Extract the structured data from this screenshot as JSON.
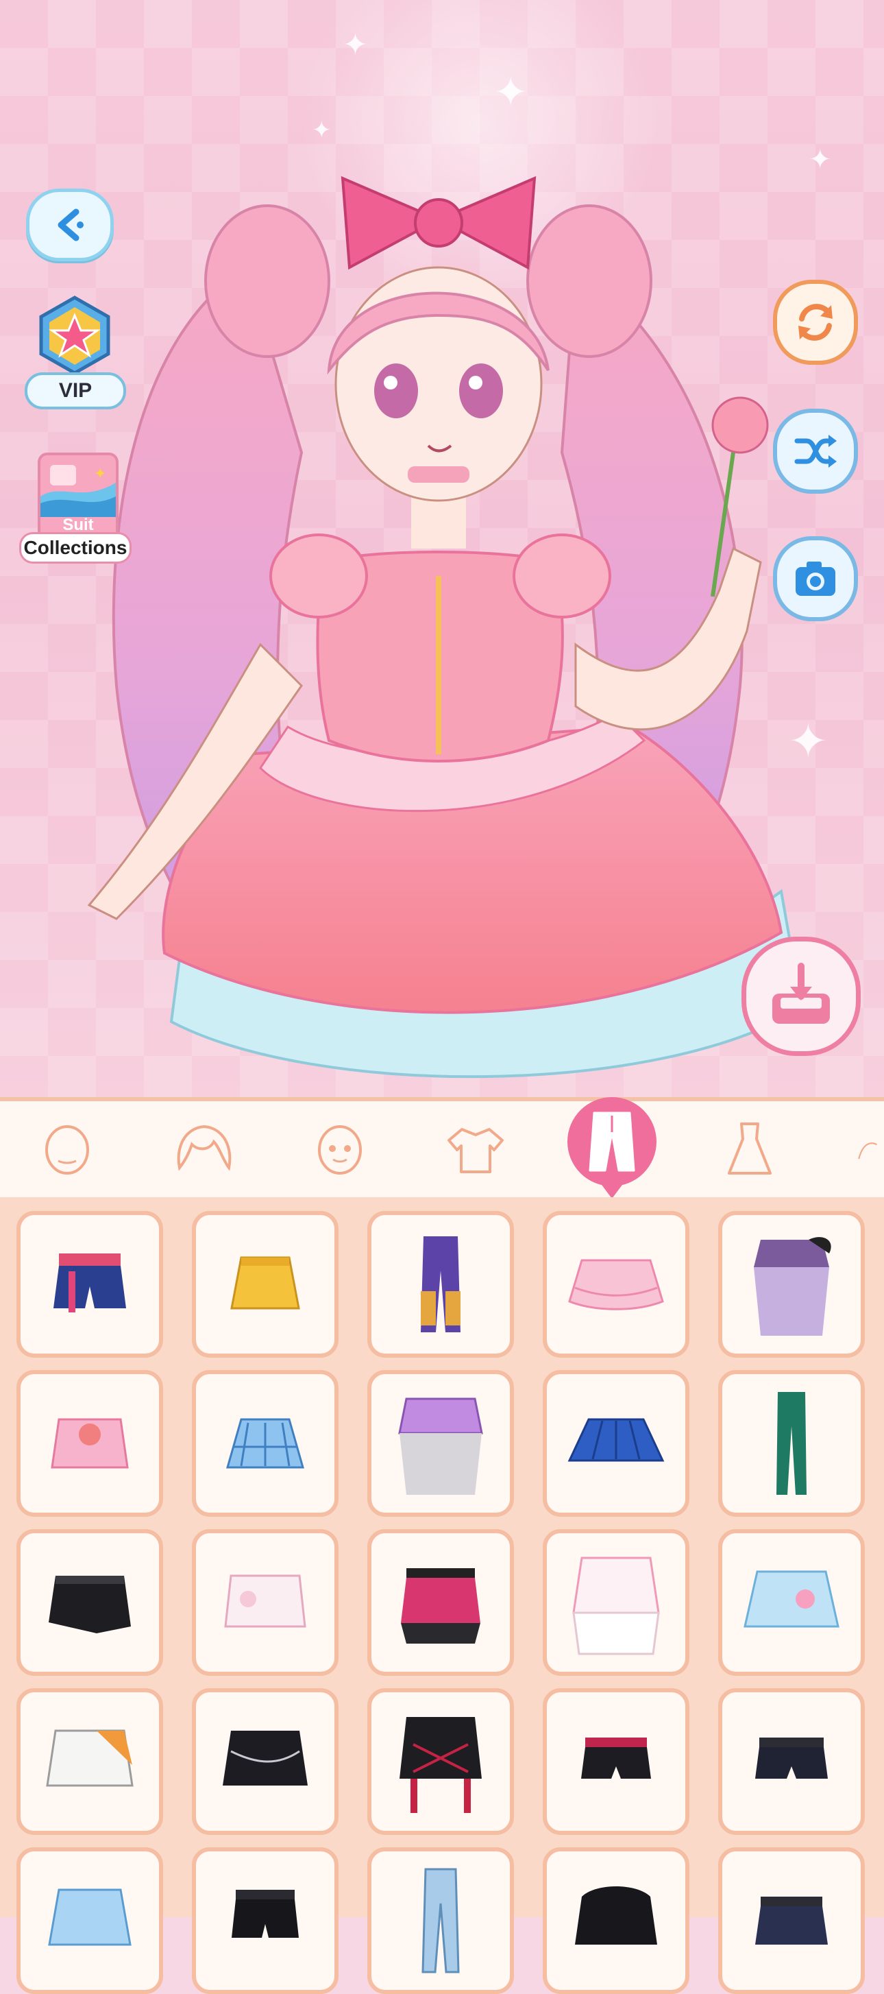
{
  "left_menu": {
    "vip_label": "VIP",
    "suit_label": "Suit",
    "collections_label": "Collections"
  },
  "tabs": [
    {
      "name": "face-tab",
      "icon": "face-icon"
    },
    {
      "name": "hair-tab",
      "icon": "hair-icon"
    },
    {
      "name": "expression-tab",
      "icon": "expression-icon"
    },
    {
      "name": "top-tab",
      "icon": "shirt-icon"
    },
    {
      "name": "bottom-tab",
      "icon": "pants-icon",
      "active": true
    },
    {
      "name": "dress-tab",
      "icon": "dress-icon"
    }
  ],
  "items": [
    "denim-shorts",
    "yellow-skirt",
    "purple-pants",
    "pink-ruffle-skirt",
    "gothic-skirt",
    "pink-apron-skirt",
    "plaid-skirt",
    "purple-tiered-skirt",
    "blue-pleated-skirt",
    "green-leggings",
    "black-skirt",
    "white-bunny-skirt",
    "pink-plaid-skirt",
    "white-lolita-skirt",
    "blue-cute-skirt",
    "orange-white-skirt",
    "black-chain-skirt",
    "red-plaid-skirt",
    "black-shorts",
    "black-studded-shorts",
    "light-blue-skirt",
    "black-belt-shorts",
    "blue-pants",
    "black-bubble-skirt",
    "navy-skirt"
  ],
  "colors": {
    "accent_pink": "#ef6e9b",
    "cell_border": "#f5bda2",
    "grid_bg": "#fad9c9"
  }
}
